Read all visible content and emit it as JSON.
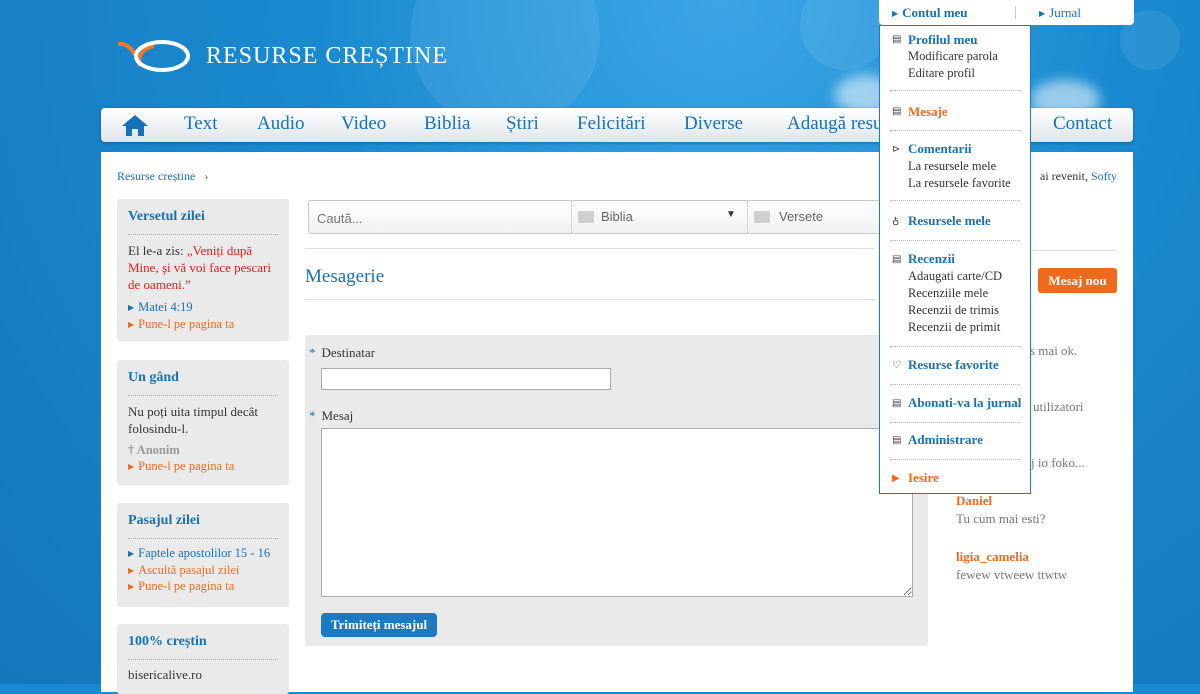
{
  "header": {
    "logo_text": "RESURSE CREȘTINE"
  },
  "nav": {
    "items": [
      "Text",
      "Audio",
      "Video",
      "Biblia",
      "Știri",
      "Felicitări",
      "Diverse",
      "Adaugă resu",
      "Contact"
    ]
  },
  "breadcrumb": {
    "label": "Resurse creștine",
    "sep": "›"
  },
  "verse_box": {
    "title": "Versetul zilei",
    "prefix": "El le-a zis: ",
    "quote": "„Veniți după Mine, şi vă voi face pescari de oameni.”",
    "ref": "Matei 4:19",
    "action": "Pune-l pe pagina ta"
  },
  "thought_box": {
    "title": "Un gând",
    "text": "Nu poți uita timpul decât folosindu-l.",
    "author": "† Anonim",
    "action": "Pune-l pe pagina ta"
  },
  "passage_box": {
    "title": "Pasajul zilei",
    "passage": "Faptele apostolilor 15 - 16",
    "listen": "Ascultă pasajul zilei",
    "action": "Pune-l pe pagina ta"
  },
  "christian_box": {
    "title": "100% creștin",
    "site": "bisericalive.ro"
  },
  "search": {
    "placeholder": "Caută...",
    "book_select": "Biblia",
    "verse_select": "Versete",
    "caret": "▼"
  },
  "main": {
    "title": "Mesagerie",
    "recipient_label": "Destinatar",
    "message_label": "Mesaj",
    "required_mark": "*",
    "recipient_value": "",
    "message_value": "",
    "send_button": "Trimiteți mesajul"
  },
  "right": {
    "welcome_prefix": "ai revenit, ",
    "welcome_user": "Softy",
    "new_message_button": "Mesaj nou",
    "fragments": [
      "s mai ok.",
      "utilizatori",
      "j io foko..."
    ],
    "messages": [
      {
        "name": "Daniel",
        "text": "Tu cum mai esti?"
      },
      {
        "name": "ligia_camelia",
        "text": "fewew vtweew ttwtw"
      }
    ]
  },
  "topbar": {
    "account": "Contul meu",
    "journal": "Jurnal"
  },
  "dropdown": {
    "profile": {
      "title": "Profilul meu",
      "items": [
        "Modificare parola",
        "Editare profil"
      ]
    },
    "messages": "Mesaje",
    "comments": {
      "title": "Comentarii",
      "items": [
        "La resursele mele",
        "La resursele favorite"
      ]
    },
    "my_resources": "Resursele mele",
    "reviews": {
      "title": "Recenzii",
      "items": [
        "Adaugati carte/CD",
        "Recenziile mele",
        "Recenzii de trimis",
        "Recenzii de primit"
      ]
    },
    "favorites": "Resurse favorite",
    "subscribe": "Abonati-va la jurnal",
    "admin": "Administrare",
    "logout": "Iesire"
  },
  "colors": {
    "background": "#1a8ad0",
    "link": "#1672b8",
    "accent": "#f06a1e",
    "red_quote": "#e0201a"
  }
}
